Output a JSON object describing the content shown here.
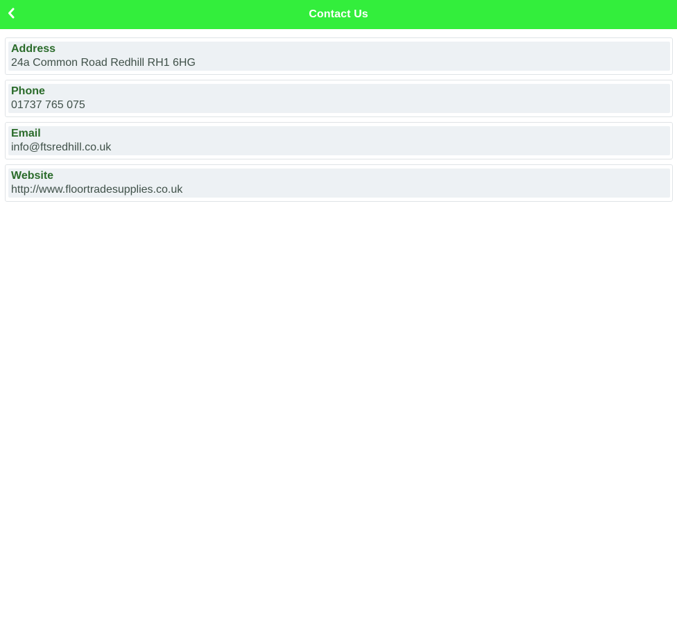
{
  "header": {
    "title": "Contact Us",
    "back_icon": "chevron-left-icon",
    "bg_color": "#33ee3c"
  },
  "contacts": [
    {
      "label": "Address",
      "value": "24a Common Road Redhill RH1 6HG"
    },
    {
      "label": "Phone",
      "value": "01737 765 075"
    },
    {
      "label": "Email",
      "value": "info@ftsredhill.co.uk"
    },
    {
      "label": "Website",
      "value": "http://www.floortradesupplies.co.uk"
    }
  ],
  "colors": {
    "label": "#2a6b2a",
    "value": "#3f5048",
    "card_bg": "#edf1f4"
  }
}
